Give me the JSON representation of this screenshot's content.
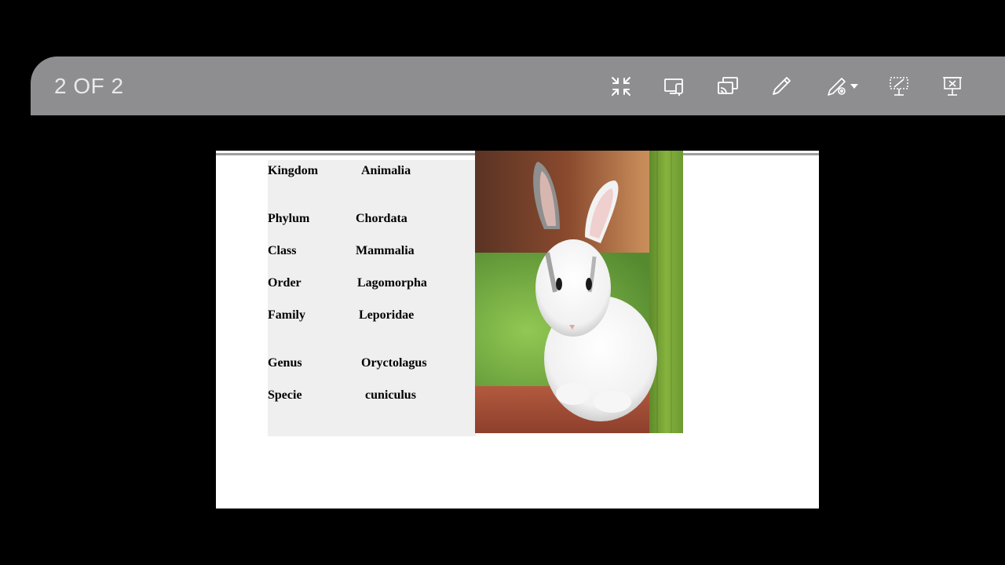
{
  "toolbar": {
    "counter": "2 OF 2",
    "tools": [
      {
        "name": "exit-fullscreen-icon"
      },
      {
        "name": "screen-share-icon"
      },
      {
        "name": "cast-icon"
      },
      {
        "name": "pen-icon"
      },
      {
        "name": "pen-settings-icon"
      },
      {
        "name": "whiteboard-icon"
      },
      {
        "name": "stop-presentation-icon"
      }
    ],
    "colors": {
      "bar": "#8e8e90",
      "icon": "#ffffff",
      "text": "#e9e9ea"
    }
  },
  "slide": {
    "taxonomy": [
      {
        "rank": "Kingdom",
        "name": "Animalia"
      },
      {
        "rank": "Phylum",
        "name": "Chordata"
      },
      {
        "rank": "Class",
        "name": "Mammalia"
      },
      {
        "rank": "Order",
        "name": "Lagomorpha"
      },
      {
        "rank": "Family",
        "name": "Leporidae"
      },
      {
        "rank": "Genus",
        "name": "Oryctolagus"
      },
      {
        "rank": "Specie",
        "name": "cuniculus"
      }
    ],
    "image": "white-rabbit-photo"
  }
}
